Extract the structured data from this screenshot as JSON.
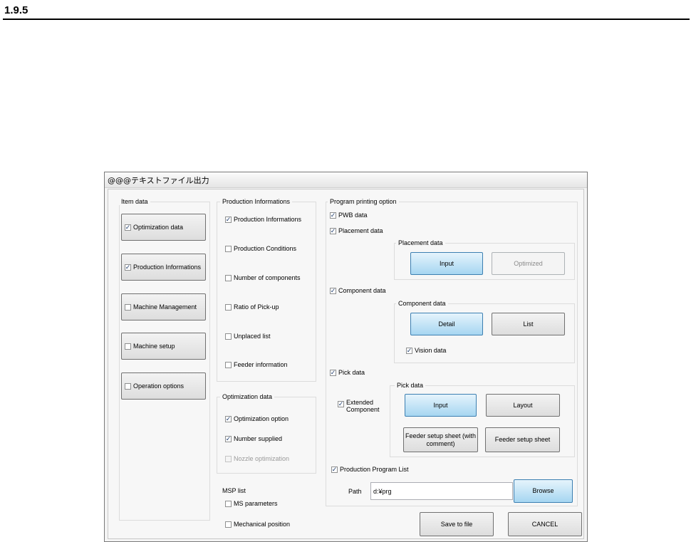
{
  "doc": {
    "section_number": "1.9.5"
  },
  "dialog": {
    "title": "@@@テキストファイル出力",
    "item_data": {
      "title": "Item data",
      "buttons": [
        {
          "label": "Optimization data",
          "checked": true,
          "check": "✓"
        },
        {
          "label": "Production Informations",
          "checked": true,
          "check": "✓"
        },
        {
          "label": "Machine Management",
          "checked": false,
          "check": ""
        },
        {
          "label": "Machine setup",
          "checked": false,
          "check": ""
        },
        {
          "label": "Operation options",
          "checked": false,
          "check": ""
        }
      ]
    },
    "production_informations": {
      "title": "Production Informations",
      "items": [
        {
          "label": "Production Informations",
          "checked": true,
          "check": "✓"
        },
        {
          "label": "Production Conditions",
          "checked": false,
          "check": ""
        },
        {
          "label": "Number of components",
          "checked": false,
          "check": ""
        },
        {
          "label": "Ratio of Pick-up",
          "checked": false,
          "check": ""
        },
        {
          "label": "Unplaced list",
          "checked": false,
          "check": ""
        },
        {
          "label": "Feeder information",
          "checked": false,
          "check": ""
        }
      ]
    },
    "optimization_data": {
      "title": "Optimization data",
      "items": [
        {
          "label": "Optimization option",
          "checked": true,
          "check": "✓"
        },
        {
          "label": "Number supplied",
          "checked": true,
          "check": "✓"
        },
        {
          "label": "Nozzle optimization",
          "checked": false,
          "check": "",
          "disabled": true
        }
      ]
    },
    "msp_list": {
      "title": "MSP list",
      "items": [
        {
          "label": "MS parameters",
          "checked": false,
          "check": ""
        },
        {
          "label": "Mechanical position",
          "checked": false,
          "check": ""
        }
      ]
    },
    "program_printing": {
      "title": "Program printing option",
      "pwb_data": {
        "label": "PWB data",
        "check": "✓"
      },
      "placement_data": {
        "label": "Placement data",
        "check": "✓"
      },
      "placement_group": {
        "title": "Placement data",
        "input": "Input",
        "optimized": "Optimized"
      },
      "component_data": {
        "label": "Component data",
        "check": "✓"
      },
      "component_group": {
        "title": "Component data",
        "detail": "Detail",
        "list": "List",
        "vision": {
          "label": "Vision data",
          "check": "✓"
        }
      },
      "pick_data": {
        "label": "Pick data",
        "check": "✓"
      },
      "extended_component": {
        "label_line1": "Extended",
        "label_line2": "Component",
        "check": "✓"
      },
      "pick_group": {
        "title": "Pick data",
        "input": "Input",
        "layout": "Layout",
        "feeder_with_comment_line1": "Feeder setup sheet (with",
        "feeder_with_comment_line2": "comment)",
        "feeder_sheet": "Feeder setup sheet"
      },
      "production_program_list": {
        "label": "Production Program List",
        "check": "✓"
      },
      "path_label": "Path",
      "path_value": "d:¥prg",
      "browse": "Browse"
    },
    "save_to_file": "Save to file",
    "cancel": "CANCEL"
  }
}
